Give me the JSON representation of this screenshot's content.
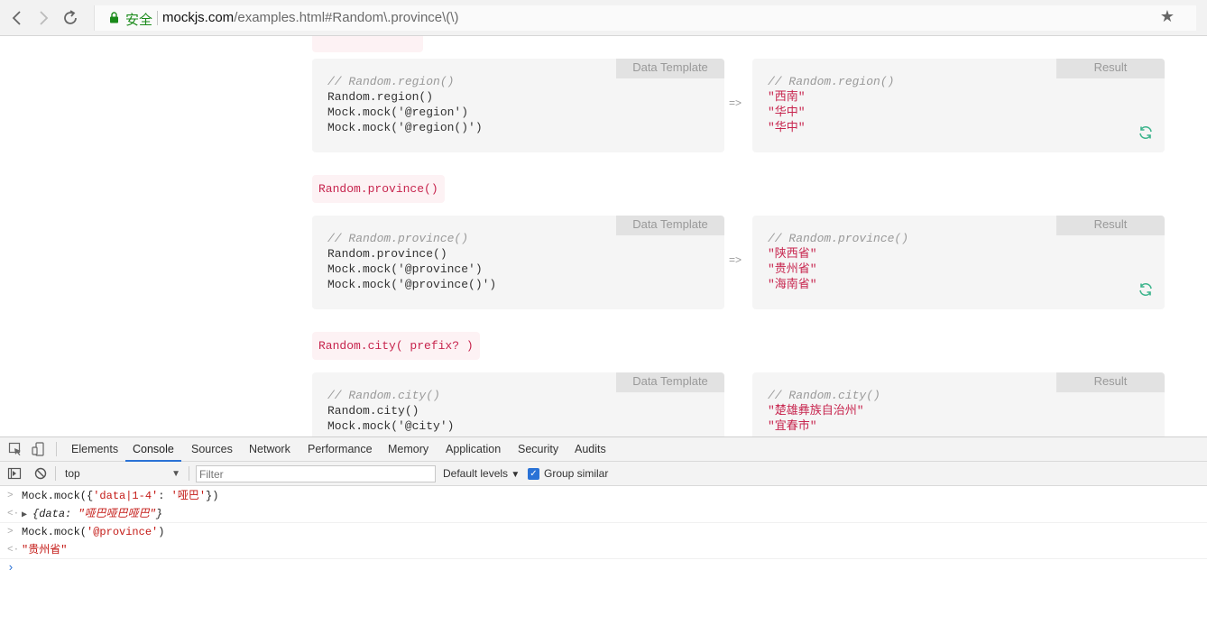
{
  "browser": {
    "secure_label": "安全",
    "url_host": "mockjs.com",
    "url_path": "/examples.html#Random\\.province\\(\\)"
  },
  "page": {
    "sections": [
      {
        "heading": "",
        "template_tag": "Data Template",
        "result_tag": "Result",
        "template_lines": [
          "// Random.region()",
          "Random.region()",
          "Mock.mock('@region')",
          "Mock.mock('@region()')"
        ],
        "result_lines": [
          "// Random.region()",
          "\"西南\"",
          "\"华中\"",
          "\"华中\""
        ],
        "arrow": "=>"
      },
      {
        "heading": "Random.province()",
        "template_tag": "Data Template",
        "result_tag": "Result",
        "template_lines": [
          "// Random.province()",
          "Random.province()",
          "Mock.mock('@province')",
          "Mock.mock('@province()')"
        ],
        "result_lines": [
          "// Random.province()",
          "\"陕西省\"",
          "\"贵州省\"",
          "\"海南省\""
        ],
        "arrow": "=>"
      },
      {
        "heading": "Random.city( prefix? )",
        "template_tag": "Data Template",
        "result_tag": "Result",
        "template_lines": [
          "// Random.city()",
          "Random.city()",
          "Mock.mock('@city')"
        ],
        "result_lines": [
          "// Random.city()",
          "\"楚雄彝族自治州\"",
          "\"宜春市\""
        ]
      }
    ]
  },
  "devtools": {
    "tabs": [
      "Elements",
      "Console",
      "Sources",
      "Network",
      "Performance",
      "Memory",
      "Application",
      "Security",
      "Audits"
    ],
    "active_tab": "Console",
    "context": "top",
    "filter_placeholder": "Filter",
    "levels": "Default levels",
    "group_similar": "Group similar",
    "console": {
      "input1_prefix": "Mock.mock({",
      "input1_key": "'data|1-4'",
      "input1_mid": ": ",
      "input1_val": "'哑巴'",
      "input1_suffix": "})",
      "output1_open": "{data: ",
      "output1_val": "\"哑巴哑巴哑巴\"",
      "output1_close": "}",
      "input2_prefix": "Mock.mock(",
      "input2_val": "'@province'",
      "input2_suffix": ")",
      "output2": "\"贵州省\""
    }
  }
}
